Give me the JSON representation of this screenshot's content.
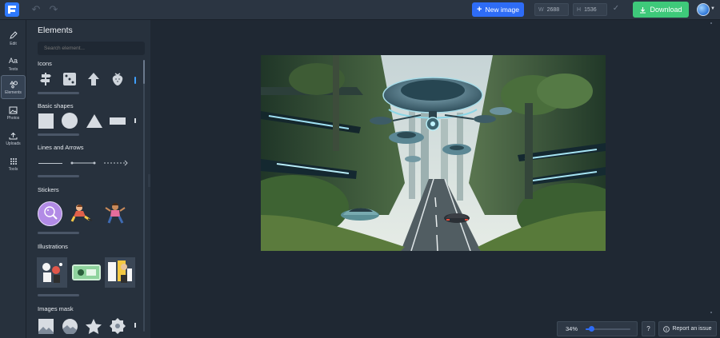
{
  "header": {
    "new_image_label": "New image",
    "width_key": "W",
    "width_value": "2688",
    "height_key": "H",
    "height_value": "1536",
    "download_label": "Download",
    "accent": "#2e6cf6",
    "download_color": "#3ec97a"
  },
  "rail": {
    "items": [
      {
        "label": "Edit",
        "icon": "pencil-icon"
      },
      {
        "label": "Texts",
        "icon": "text-icon"
      },
      {
        "label": "Elements",
        "icon": "shapes-icon"
      },
      {
        "label": "Photos",
        "icon": "image-icon"
      },
      {
        "label": "Uploads",
        "icon": "upload-icon"
      },
      {
        "label": "Tools",
        "icon": "grid-icon"
      }
    ],
    "active": "Elements"
  },
  "panel": {
    "title": "Elements",
    "search_placeholder": "Search element...",
    "sections": {
      "icons": "Icons",
      "basic_shapes": "Basic shapes",
      "lines_arrows": "Lines and Arrows",
      "stickers": "Stickers",
      "illustrations": "Illustrations",
      "images_mask": "Images mask"
    }
  },
  "footer": {
    "zoom_label": "34%",
    "zoom_fraction": 0.12,
    "help_label": "?",
    "report_label": "Report an issue"
  }
}
